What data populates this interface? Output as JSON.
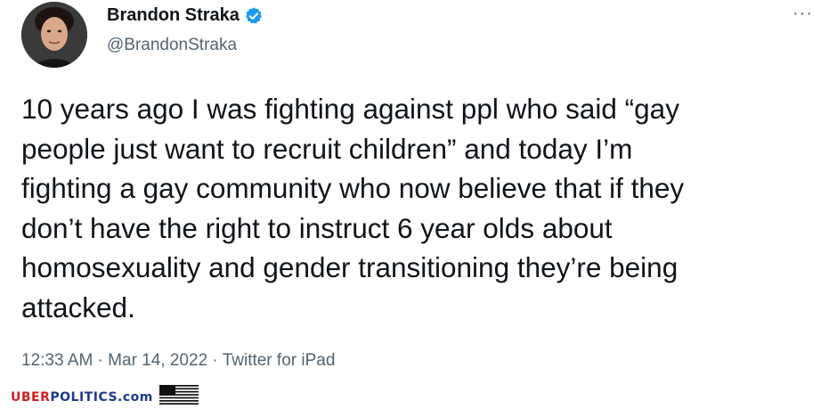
{
  "author": {
    "display_name": "Brandon Straka",
    "handle": "@BrandonStraka",
    "verified": true,
    "avatar_icon": "profile-photo",
    "verified_icon": "verified-badge-icon"
  },
  "more_button": {
    "label": "···",
    "icon": "more-options-icon"
  },
  "tweet": {
    "lines": [
      "10 years ago I was fighting against ppl who said “gay",
      "people just want to recruit children” and today I’m",
      "fighting a gay community who now believe that if they",
      "don’t have the right to instruct 6 year olds about",
      "homosexuality and gender transitioning they’re being",
      "attacked."
    ]
  },
  "meta": {
    "time": "12:33 AM",
    "sep1": " · ",
    "date": "Mar 14, 2022",
    "sep2": " · ",
    "source": "Twitter for iPad"
  },
  "watermark": {
    "part1": "UBER",
    "part2": "POLITICS.com",
    "flag_icon": "us-flag-icon"
  },
  "colors": {
    "text": "#0f1419",
    "secondary": "#536471",
    "verified": "#1d9bf0",
    "watermark_red": "#d21f1f",
    "watermark_blue": "#1d3a8a"
  }
}
